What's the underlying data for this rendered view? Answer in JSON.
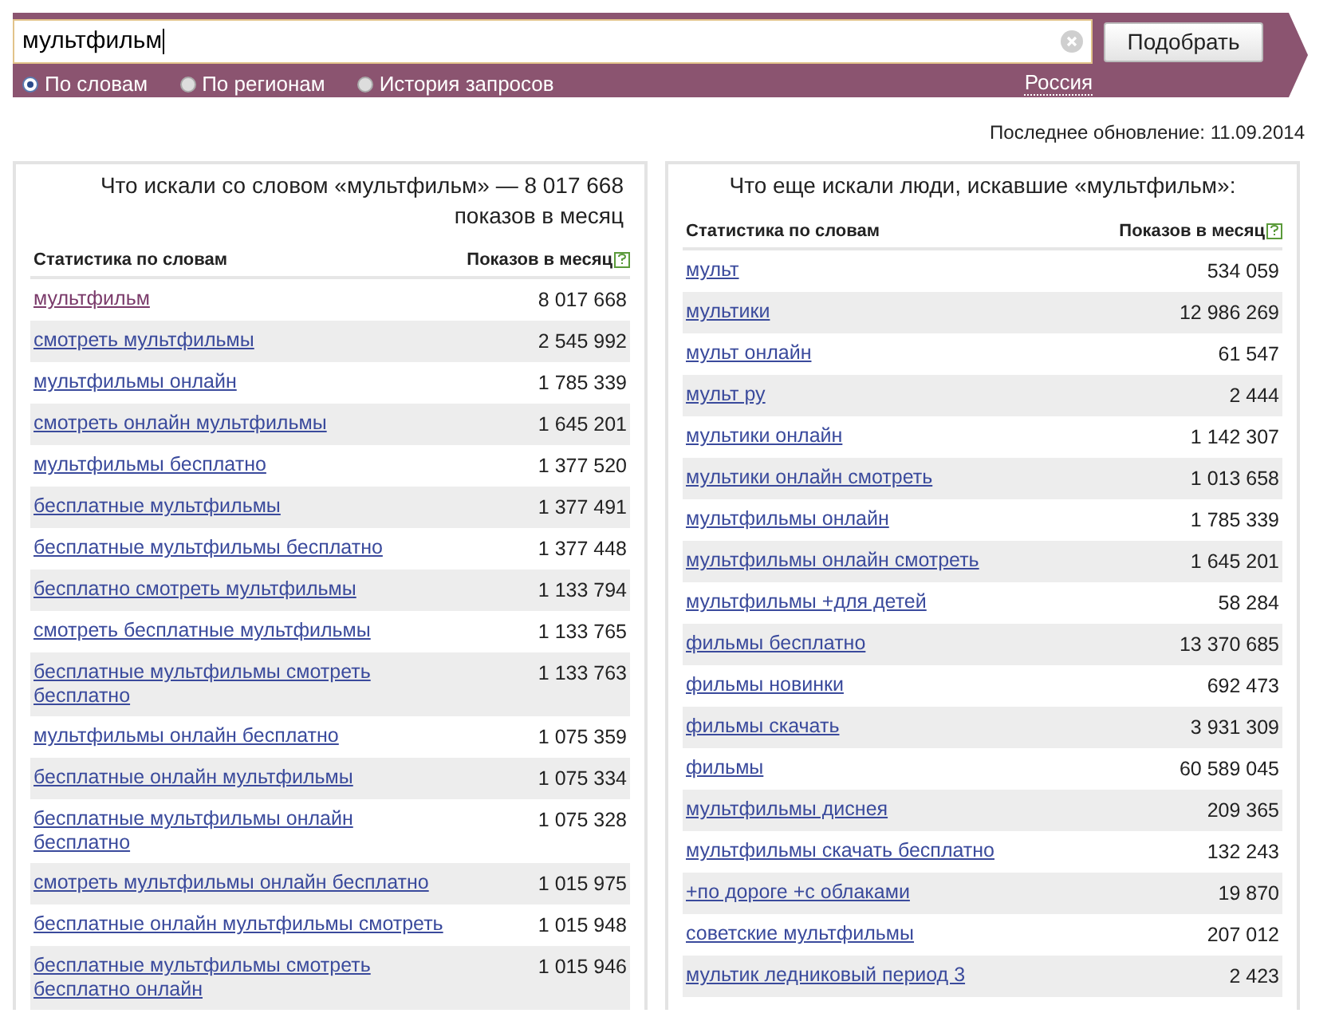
{
  "search": {
    "value": "мультфильм",
    "button": "Подобрать"
  },
  "modes": [
    {
      "label": "По словам",
      "selected": true
    },
    {
      "label": "По регионам",
      "selected": false
    },
    {
      "label": "История запросов",
      "selected": false
    }
  ],
  "region": "Россия",
  "last_update": "Последнее обновление: 11.09.2014",
  "panels": [
    {
      "title": "Что искали со словом «мультфильм» — 8 017 668 показов в месяц",
      "columns": [
        "Статистика по словам",
        "Показов в месяц"
      ],
      "rows": [
        {
          "phrase": "мультфильм",
          "count": "8 017 668",
          "visited": true
        },
        {
          "phrase": "смотреть мультфильмы",
          "count": "2 545 992",
          "visited": false
        },
        {
          "phrase": "мультфильмы онлайн",
          "count": "1 785 339",
          "visited": false
        },
        {
          "phrase": "смотреть онлайн мультфильмы",
          "count": "1 645 201",
          "visited": false
        },
        {
          "phrase": "мультфильмы бесплатно",
          "count": "1 377 520",
          "visited": false
        },
        {
          "phrase": "бесплатные мультфильмы",
          "count": "1 377 491",
          "visited": false
        },
        {
          "phrase": "бесплатные мультфильмы бесплатно",
          "count": "1 377 448",
          "visited": false
        },
        {
          "phrase": "бесплатно смотреть мультфильмы",
          "count": "1 133 794",
          "visited": false
        },
        {
          "phrase": "смотреть бесплатные мультфильмы",
          "count": "1 133 765",
          "visited": false
        },
        {
          "phrase": "бесплатные мультфильмы смотреть\nбесплатно",
          "count": "1 133 763",
          "visited": false
        },
        {
          "phrase": "мультфильмы онлайн бесплатно",
          "count": "1 075 359",
          "visited": false
        },
        {
          "phrase": "бесплатные онлайн мультфильмы",
          "count": "1 075 334",
          "visited": false
        },
        {
          "phrase": "бесплатные мультфильмы онлайн\nбесплатно",
          "count": "1 075 328",
          "visited": false
        },
        {
          "phrase": "смотреть мультфильмы онлайн бесплатно",
          "count": "1 015 975",
          "visited": false
        },
        {
          "phrase": "бесплатные онлайн мультфильмы смотреть",
          "count": "1 015 948",
          "visited": false
        },
        {
          "phrase": "бесплатные мультфильмы смотреть\nбесплатно онлайн",
          "count": "1 015 946",
          "visited": false
        }
      ]
    },
    {
      "title": "Что еще искали люди, искавшие «мультфильм»:",
      "columns": [
        "Статистика по словам",
        "Показов в месяц"
      ],
      "rows": [
        {
          "phrase": "мульт",
          "count": "534 059",
          "visited": false
        },
        {
          "phrase": "мультики",
          "count": "12 986 269",
          "visited": false
        },
        {
          "phrase": "мульт онлайн",
          "count": "61 547",
          "visited": false
        },
        {
          "phrase": "мульт ру",
          "count": "2 444",
          "visited": false
        },
        {
          "phrase": "мультики онлайн",
          "count": "1 142 307",
          "visited": false
        },
        {
          "phrase": "мультики онлайн смотреть",
          "count": "1 013 658",
          "visited": false
        },
        {
          "phrase": "мультфильмы онлайн",
          "count": "1 785 339",
          "visited": false
        },
        {
          "phrase": "мультфильмы онлайн смотреть",
          "count": "1 645 201",
          "visited": false
        },
        {
          "phrase": "мультфильмы +для детей",
          "count": "58 284",
          "visited": false
        },
        {
          "phrase": "фильмы бесплатно",
          "count": "13 370 685",
          "visited": false
        },
        {
          "phrase": "фильмы новинки",
          "count": "692 473",
          "visited": false
        },
        {
          "phrase": "фильмы скачать",
          "count": "3 931 309",
          "visited": false
        },
        {
          "phrase": "фильмы",
          "count": "60 589 045",
          "visited": false
        },
        {
          "phrase": "мультфильмы диснея",
          "count": "209 365",
          "visited": false
        },
        {
          "phrase": "мультфильмы скачать бесплатно",
          "count": "132 243",
          "visited": false
        },
        {
          "phrase": "+по дороге +с облаками",
          "count": "19 870",
          "visited": false
        },
        {
          "phrase": "советские мультфильмы",
          "count": "207 012",
          "visited": false
        },
        {
          "phrase": "мультик ледниковый период 3",
          "count": "2 423",
          "visited": false
        }
      ]
    }
  ]
}
